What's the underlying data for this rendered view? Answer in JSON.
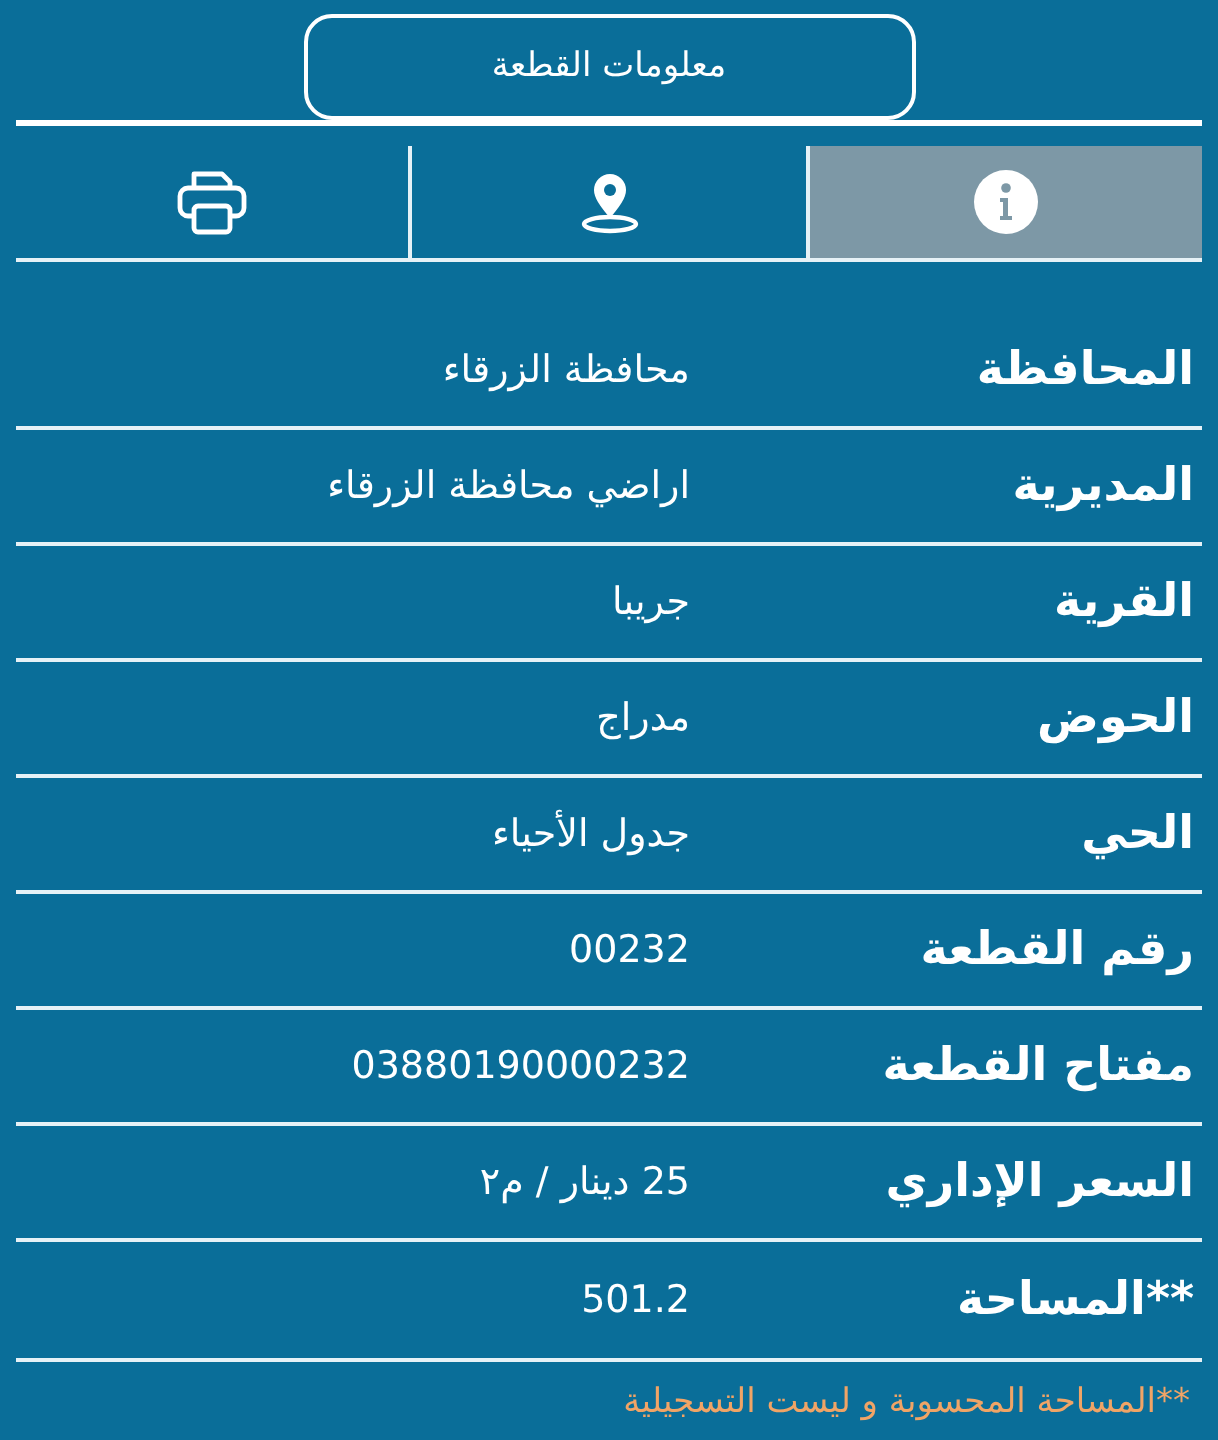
{
  "header": {
    "title": "معلومات القطعة"
  },
  "tabs": [
    {
      "kind": "info",
      "selected": true
    },
    {
      "kind": "location",
      "selected": false
    },
    {
      "kind": "print",
      "selected": false
    }
  ],
  "rows": [
    {
      "label": "المحافظة",
      "value": "محافظة الزرقاء"
    },
    {
      "label": "المديرية",
      "value": "اراضي محافظة الزرقاء"
    },
    {
      "label": "القرية",
      "value": "جريبا"
    },
    {
      "label": "الحوض",
      "value": "مدراج"
    },
    {
      "label": "الحي",
      "value": "جدول الأحياء"
    },
    {
      "label": "رقم القطعة",
      "value": "00232"
    },
    {
      "label": "مفتاح القطعة",
      "value": "03880190000232"
    },
    {
      "label": "السعر الإداري",
      "value": "25 دينار / م٢"
    },
    {
      "label": "**المساحة",
      "value": "501.2"
    }
  ],
  "footnote": "**المساحة المحسوبة و ليست التسجيلية"
}
